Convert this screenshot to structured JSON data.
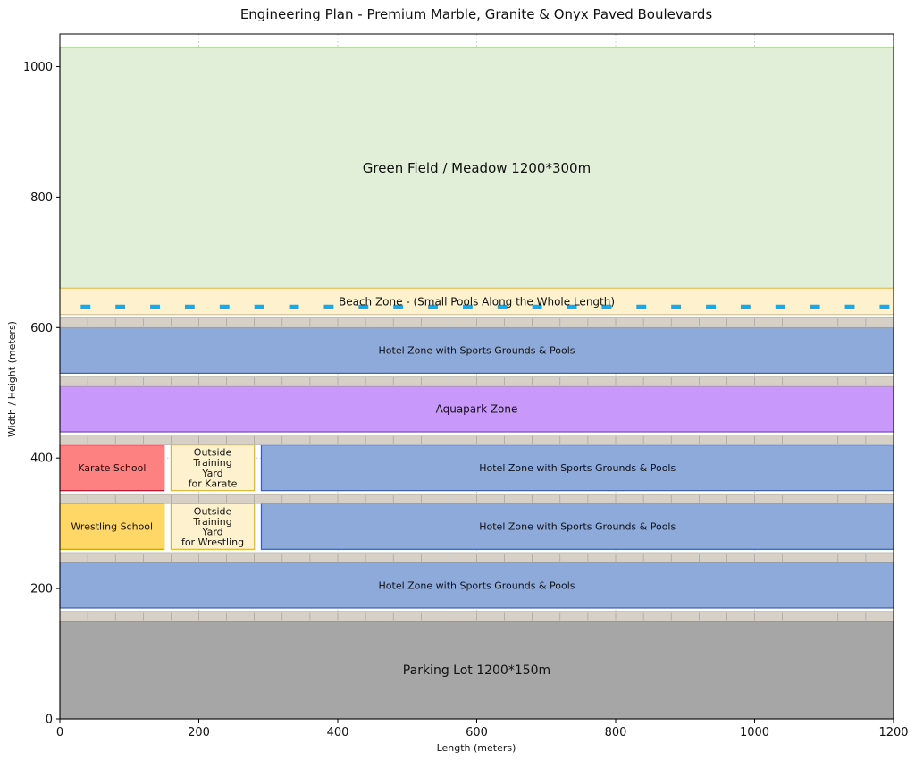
{
  "title": "Engineering Plan - Premium Marble, Granite & Onyx Paved Boulevards",
  "xlabel": "Length (meters)",
  "ylabel": "Width / Height (meters)",
  "xlim": [
    0,
    1200
  ],
  "ylim": [
    0,
    1050
  ],
  "xticks": [
    0,
    200,
    400,
    600,
    800,
    1000,
    1200
  ],
  "yticks": [
    0,
    200,
    400,
    600,
    800,
    1000
  ],
  "grid": true,
  "zones": [
    {
      "id": "green-field",
      "label": "Green Field / Meadow 1200*300m",
      "x0": 0,
      "x1": 1200,
      "y0": 660,
      "y1": 1030,
      "fill": "#e1efd8",
      "stroke": "#3a5e2a",
      "text": "#3a5e2a",
      "font": 15
    },
    {
      "id": "beach-zone",
      "label": "Beach Zone - (Small Pools Along the Whole Length)",
      "x0": 0,
      "x1": 1200,
      "y0": 620,
      "y1": 660,
      "fill": "#fdf2cd",
      "stroke": "#e7c56b",
      "text": "#111111",
      "font": 12
    },
    {
      "id": "hotel-zone-top",
      "label": "Hotel Zone with Sports Grounds & Pools",
      "x0": 0,
      "x1": 1200,
      "y0": 530,
      "y1": 600,
      "fill": "#8eaadb",
      "stroke": "#3d5ea6",
      "text": "#111111",
      "font": 11
    },
    {
      "id": "aquapark-zone",
      "label": "Aquapark Zone",
      "x0": 0,
      "x1": 1200,
      "y0": 440,
      "y1": 510,
      "fill": "#c898fa",
      "stroke": "#7a4ab3",
      "text": "#111111",
      "font": 12
    },
    {
      "id": "karate-school",
      "label": "Karate School",
      "x0": 0,
      "x1": 150,
      "y0": 350,
      "y1": 420,
      "fill": "#fe8181",
      "stroke": "#c01030",
      "text": "#111111",
      "font": 11
    },
    {
      "id": "karate-yard",
      "label": "Outside\nTraining\nYard\nfor Karate",
      "x0": 160,
      "x1": 280,
      "y0": 350,
      "y1": 420,
      "fill": "#fdf2cd",
      "stroke": "#d9b830",
      "text": "#111111",
      "font": 11
    },
    {
      "id": "hotel-zone-karate-row",
      "label": "Hotel Zone with Sports Grounds & Pools",
      "x0": 290,
      "x1": 1200,
      "y0": 350,
      "y1": 420,
      "fill": "#8eaadb",
      "stroke": "#3d5ea6",
      "text": "#111111",
      "font": 11
    },
    {
      "id": "wrestling-school",
      "label": "Wrestling School",
      "x0": 0,
      "x1": 150,
      "y0": 260,
      "y1": 330,
      "fill": "#fed767",
      "stroke": "#c9a200",
      "text": "#111111",
      "font": 11
    },
    {
      "id": "wrestling-yard",
      "label": "Outside\nTraining\nYard\nfor Wrestling",
      "x0": 160,
      "x1": 280,
      "y0": 260,
      "y1": 330,
      "fill": "#fdf2cd",
      "stroke": "#d9b830",
      "text": "#111111",
      "font": 11
    },
    {
      "id": "hotel-zone-wrestling-row",
      "label": "Hotel Zone with Sports Grounds & Pools",
      "x0": 290,
      "x1": 1200,
      "y0": 260,
      "y1": 330,
      "fill": "#8eaadb",
      "stroke": "#3d5ea6",
      "text": "#111111",
      "font": 11
    },
    {
      "id": "hotel-zone-bottom",
      "label": "Hotel Zone with Sports Grounds & Pools",
      "x0": 0,
      "x1": 1200,
      "y0": 170,
      "y1": 240,
      "fill": "#8eaadb",
      "stroke": "#3d5ea6",
      "text": "#111111",
      "font": 11
    },
    {
      "id": "parking-lot",
      "label": "Parking Lot 1200*150m",
      "x0": 0,
      "x1": 1200,
      "y0": 0,
      "y1": 150,
      "fill": "#a6a6a6",
      "stroke": "#5a5a5a",
      "text": "#111111",
      "font": 14
    }
  ],
  "boulevards": [
    {
      "y0": 600,
      "y1": 615
    },
    {
      "y0": 510,
      "y1": 525
    },
    {
      "y0": 420,
      "y1": 435
    },
    {
      "y0": 330,
      "y1": 345
    },
    {
      "y0": 240,
      "y1": 255
    },
    {
      "y0": 150,
      "y1": 165
    }
  ],
  "boulevard_style": {
    "fill": "#d6d0c6",
    "stroke": "#bdb6aa",
    "joint_color": "#9a9a9a",
    "joint_spacing": 40
  },
  "small_pools": {
    "x_start": 37,
    "spacing": 50,
    "count": 24,
    "y": 628,
    "width": 14,
    "height": 7,
    "color": "#19a9e8"
  },
  "colors": {
    "grid": "#b8b8b8",
    "axis": "#000000"
  }
}
